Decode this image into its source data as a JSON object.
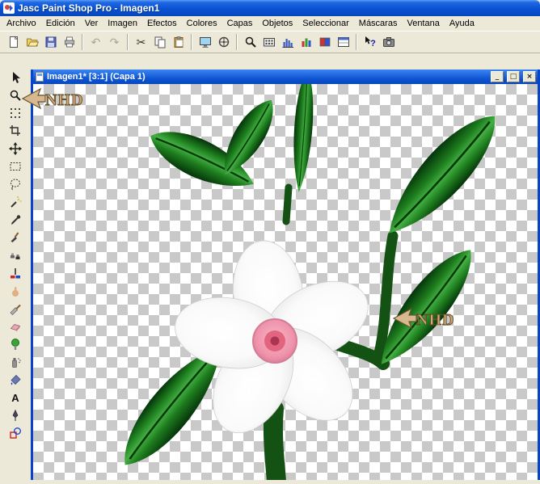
{
  "app": {
    "title": "Jasc Paint Shop Pro - Imagen1"
  },
  "menu_bar": {
    "items": [
      "Archivo",
      "Edición",
      "Ver",
      "Imagen",
      "Efectos",
      "Colores",
      "Capas",
      "Objetos",
      "Seleccionar",
      "Máscaras",
      "Ventana",
      "Ayuda"
    ]
  },
  "toolbar": {
    "buttons": [
      "new",
      "open",
      "save",
      "print",
      "undo",
      "redo",
      "cut",
      "copy",
      "paste",
      "full-screen-preview",
      "normal-viewing",
      "zoom",
      "numeric-edit",
      "histogram",
      "color-histogram",
      "toggle-palette",
      "layer-palette",
      "context-help",
      "capture"
    ],
    "glyphs": {
      "undo": "↶",
      "redo": "↷",
      "cut": "✂",
      "help": "?"
    }
  },
  "tool_palette": {
    "tools": [
      "arrow",
      "zoom",
      "deformation",
      "crop",
      "mover",
      "selection",
      "freehand-selection",
      "magic-wand",
      "dropper",
      "paintbrush",
      "clone-brush",
      "color-replacer",
      "retouch",
      "scratch-remover",
      "eraser",
      "picture-tube",
      "airbrush",
      "flood-fill",
      "text",
      "draw",
      "preset-shapes"
    ],
    "text_glyph": "A"
  },
  "document_window": {
    "title": "Imagen1* [3:1] (Capa 1)",
    "controls": {
      "minimize": "_",
      "restore": "□",
      "close": "×"
    }
  },
  "canvas": {
    "watermark_text": "NHD"
  },
  "colors": {
    "titlebar_blue": "#0A51D1",
    "window_chrome": "#ECE9D8",
    "child_border_blue": "#0843C8",
    "checker_light": "#FFFFFF",
    "checker_dark": "#C9C9C9",
    "leaf_dark_green": "#04320A",
    "leaf_mid_green": "#45B045",
    "stem_green": "#145214",
    "petal_white": "#FFFFFF",
    "petal_shade": "#D6D6D6",
    "flower_center_pink": "#EF93AB",
    "flower_center_rose": "#E2647F",
    "stamp_tan": "#D8B88E",
    "stamp_outline": "#6A5430"
  }
}
